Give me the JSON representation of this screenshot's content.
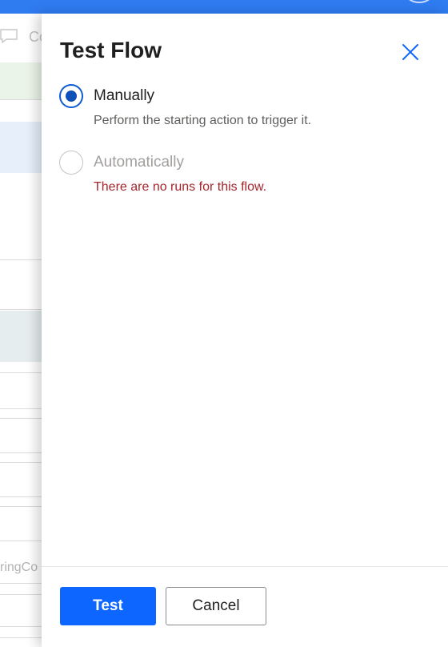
{
  "background": {
    "comment_label": "Co",
    "partial_text": "ringCo"
  },
  "panel": {
    "title": "Test Flow",
    "close_icon": "close-icon"
  },
  "options": [
    {
      "label": "Manually",
      "description": "Perform the starting action to trigger it.",
      "selected": true,
      "disabled": false
    },
    {
      "label": "Automatically",
      "description": "There are no runs for this flow.",
      "selected": false,
      "disabled": true
    }
  ],
  "footer": {
    "test_label": "Test",
    "cancel_label": "Cancel"
  },
  "colors": {
    "accent": "#0d66ff",
    "radio_selected": "#0f4fb8",
    "error_text": "#a4262c",
    "disabled_text": "#a19f9d",
    "top_bar": "#2f7bf0"
  }
}
